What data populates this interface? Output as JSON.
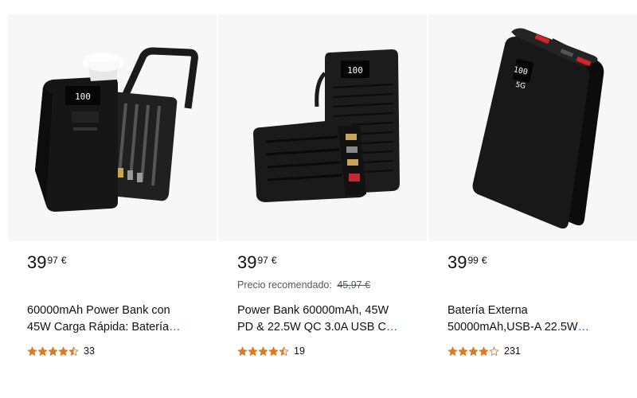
{
  "products": [
    {
      "price_whole": "39",
      "price_fraction": "97",
      "currency": "€",
      "title_line1": "60000mAh Power Bank con",
      "title_line2": "45W Carga Rápida: Batería",
      "ellipsis": "…",
      "rating": 4.5,
      "review_count": "33",
      "image": "black-power-bank-with-flip-handle-and-built-in-cables"
    },
    {
      "price_whole": "39",
      "price_fraction": "97",
      "currency": "€",
      "recommended_label": "Precio recomendado:",
      "recommended_price": "45,97 €",
      "title_line1": "Power Bank 60000mAh, 45W",
      "title_line2": "PD & 22.5W QC 3.0A USB C",
      "ellipsis": "…",
      "rating": 4.5,
      "review_count": "19",
      "image": "ribbed-black-power-bank-with-display-and-built-in-cables"
    },
    {
      "price_whole": "39",
      "price_fraction": "99",
      "currency": "€",
      "title_line1": "Batería Externa",
      "title_line2": "50000mAh,USB-A 22.5W",
      "ellipsis": "…",
      "rating": 4,
      "review_count": "231",
      "image": "black-power-bank-with-red-usb-ports-and-led-display"
    }
  ],
  "colors": {
    "star": "#de7921",
    "link": "#2162a1",
    "muted_text": "#565959",
    "image_background": "#f7f7f7"
  }
}
